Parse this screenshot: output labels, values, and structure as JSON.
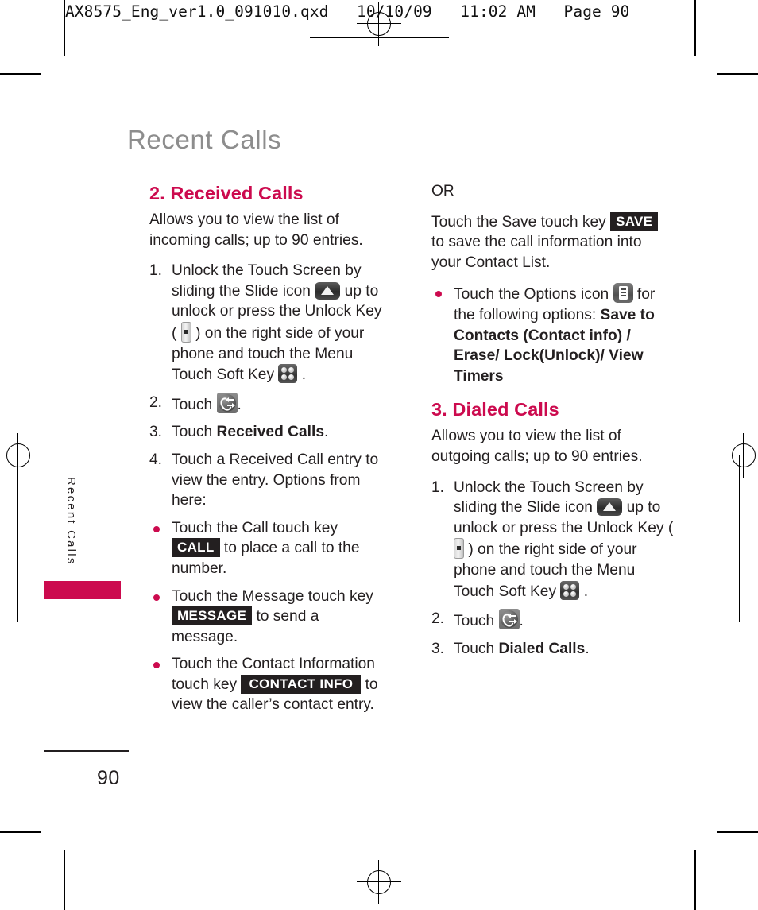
{
  "print_header": "AX8575_Eng_ver1.0_091010.qxd   10/10/09   11:02 AM   Page 90",
  "chapter_title": "Recent Calls",
  "side_tab": "Recent Calls",
  "page_number": "90",
  "colors": {
    "accent": "#cc0a4e",
    "title_gray": "#8d8d8d",
    "body": "#231f20",
    "key_bg": "#231f20"
  },
  "left_column": {
    "section_title": "2. Received Calls",
    "intro": "Allows you to view the list of incoming calls; up to 90 entries.",
    "steps": [
      {
        "num": "1.",
        "parts": [
          {
            "t": "text",
            "v": "Unlock the Touch Screen by sliding the Slide icon "
          },
          {
            "t": "icon",
            "v": "slide-icon"
          },
          {
            "t": "text",
            "v": " up to unlock or press the Unlock Key ( "
          },
          {
            "t": "icon",
            "v": "unlock-key-icon"
          },
          {
            "t": "text",
            "v": " ) on the right side of your phone and touch the Menu Touch Soft Key "
          },
          {
            "t": "icon",
            "v": "menu-touch-soft-key-icon"
          },
          {
            "t": "text",
            "v": " ."
          }
        ]
      },
      {
        "num": "2.",
        "parts": [
          {
            "t": "text",
            "v": "Touch "
          },
          {
            "t": "icon",
            "v": "recent-calls-icon"
          },
          {
            "t": "text",
            "v": "."
          }
        ]
      },
      {
        "num": "3.",
        "parts": [
          {
            "t": "text",
            "v": "Touch "
          },
          {
            "t": "bold",
            "v": "Received Calls"
          },
          {
            "t": "text",
            "v": "."
          }
        ]
      },
      {
        "num": "4.",
        "parts": [
          {
            "t": "text",
            "v": "Touch a Received Call entry to view the entry. Options from here:"
          }
        ]
      }
    ],
    "bullets": [
      {
        "parts": [
          {
            "t": "text",
            "v": "Touch the Call touch key "
          },
          {
            "t": "key",
            "v": "CALL"
          },
          {
            "t": "text",
            "v": " to place a call to the number."
          }
        ]
      },
      {
        "parts": [
          {
            "t": "text",
            "v": "Touch the Message touch key "
          },
          {
            "t": "key",
            "v": "MESSAGE"
          },
          {
            "t": "text",
            "v": " to send a message."
          }
        ]
      },
      {
        "parts": [
          {
            "t": "text",
            "v": "Touch the Contact Information touch key "
          },
          {
            "t": "key",
            "v": "CONTACT INFO"
          },
          {
            "t": "text",
            "v": " to view the caller’s contact entry."
          }
        ]
      }
    ]
  },
  "right_column": {
    "or_label": "OR",
    "save_paragraph": {
      "parts": [
        {
          "t": "text",
          "v": "Touch the Save touch key "
        },
        {
          "t": "key",
          "v": "SAVE"
        },
        {
          "t": "text",
          "v": " to save the call information into your Contact List."
        }
      ]
    },
    "options_bullet": {
      "parts": [
        {
          "t": "text",
          "v": "Touch the Options icon "
        },
        {
          "t": "icon",
          "v": "options-icon"
        },
        {
          "t": "text",
          "v": " for the following options: "
        },
        {
          "t": "bold",
          "v": "Save to Contacts (Contact info) / Erase/ Lock(Unlock)/ View Timers"
        }
      ]
    },
    "section_title": "3. Dialed Calls",
    "intro": "Allows you to view the list of outgoing calls; up to 90 entries.",
    "steps": [
      {
        "num": "1.",
        "parts": [
          {
            "t": "text",
            "v": "Unlock the Touch Screen by sliding the Slide icon "
          },
          {
            "t": "icon",
            "v": "slide-icon"
          },
          {
            "t": "text",
            "v": " up to unlock or press the Unlock Key ( "
          },
          {
            "t": "icon",
            "v": "unlock-key-icon"
          },
          {
            "t": "text",
            "v": " ) on the right side of your phone and touch the Menu Touch Soft Key "
          },
          {
            "t": "icon",
            "v": "menu-touch-soft-key-icon"
          },
          {
            "t": "text",
            "v": " ."
          }
        ]
      },
      {
        "num": "2.",
        "parts": [
          {
            "t": "text",
            "v": "Touch "
          },
          {
            "t": "icon",
            "v": "recent-calls-icon"
          },
          {
            "t": "text",
            "v": "."
          }
        ]
      },
      {
        "num": "3.",
        "parts": [
          {
            "t": "text",
            "v": "Touch "
          },
          {
            "t": "bold",
            "v": "Dialed Calls"
          },
          {
            "t": "text",
            "v": "."
          }
        ]
      }
    ]
  }
}
